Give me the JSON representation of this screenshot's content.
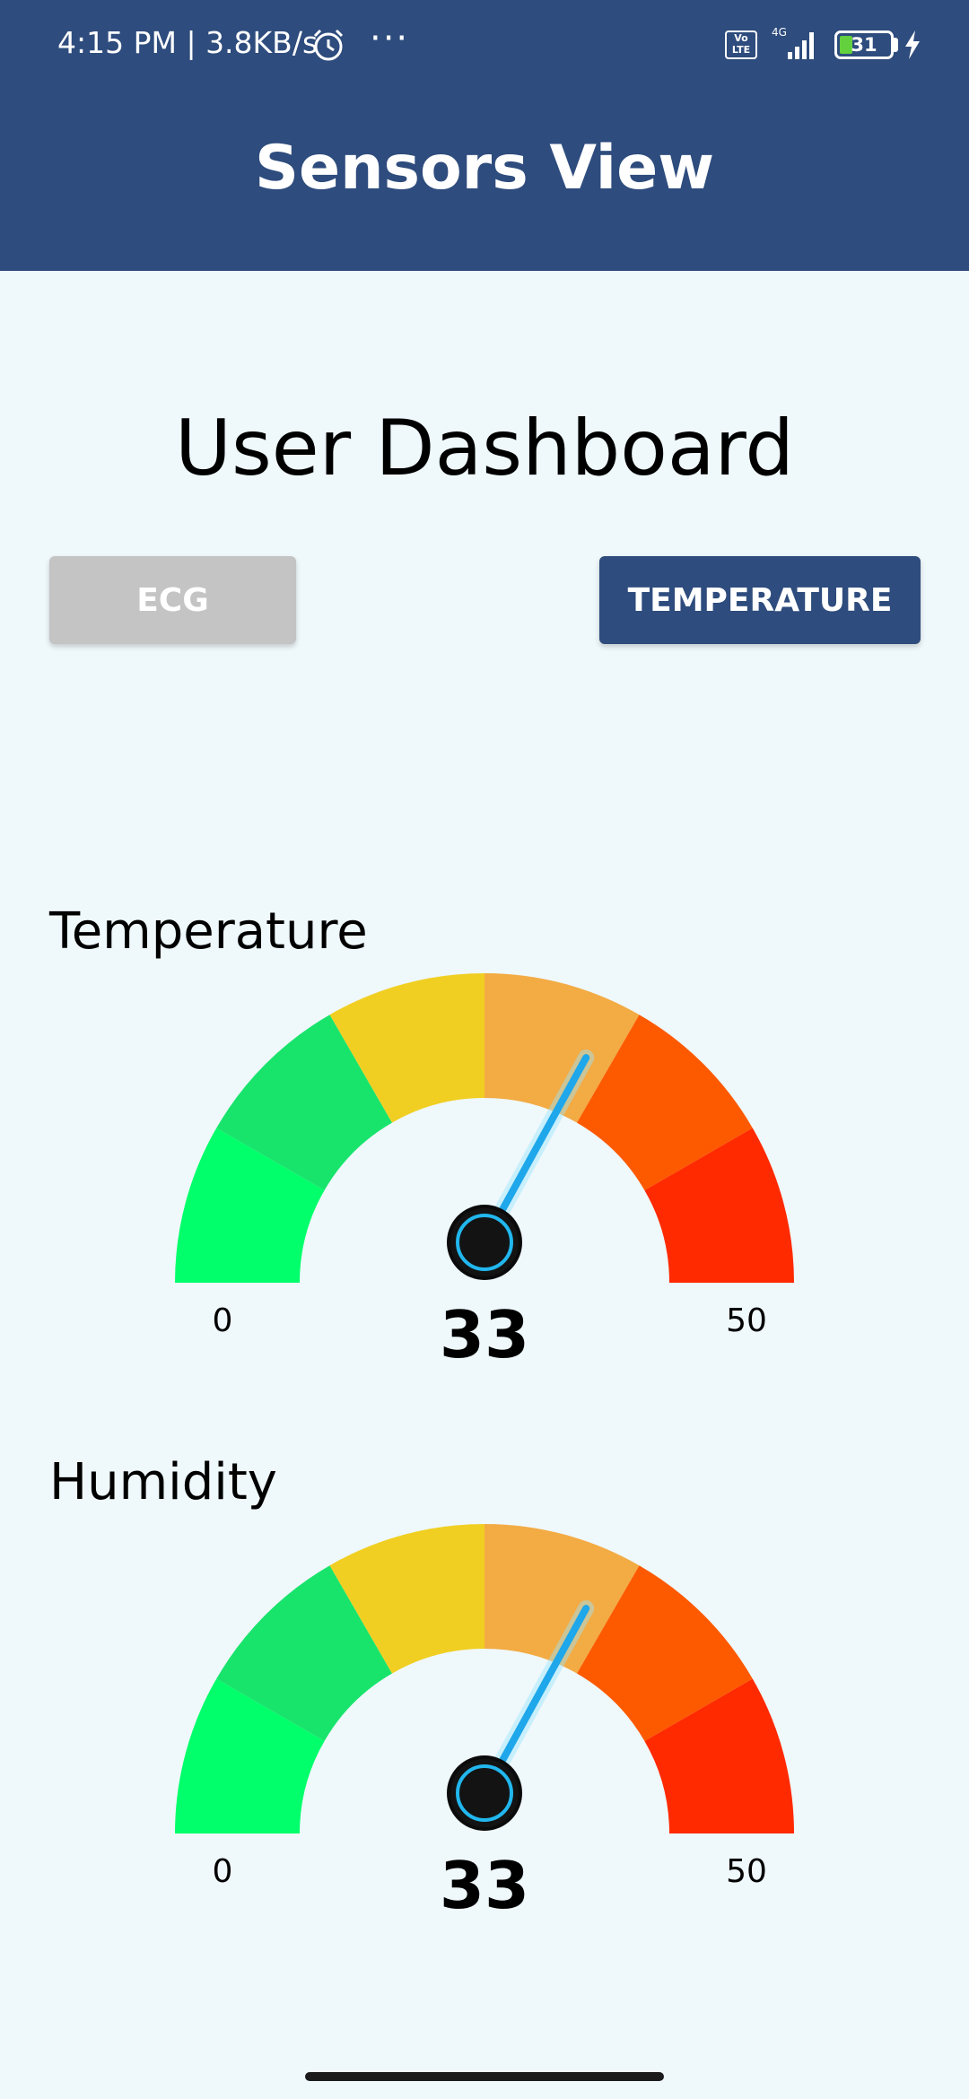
{
  "status_bar": {
    "time": "4:15 PM | 3.8KB/s",
    "dots": "···",
    "volte": "Vo LTE",
    "network": "4G",
    "battery": "31"
  },
  "header": {
    "title": "Sensors View"
  },
  "main": {
    "title": "User Dashboard",
    "buttons": {
      "ecg": "ECG",
      "temperature": "TEMPERATURE"
    }
  },
  "gauges": [
    {
      "label": "Temperature",
      "min_label": "0",
      "max_label": "50",
      "value_label": "33",
      "min": 0,
      "max": 50,
      "value": 33
    },
    {
      "label": "Humidity",
      "min_label": "0",
      "max_label": "50",
      "value_label": "33",
      "min": 0,
      "max": 50,
      "value": 33
    }
  ],
  "colors": {
    "header": "#2e4c7d",
    "background": "#eff8fb",
    "button_inactive": "#c4c4c4",
    "button_active": "#2e4c7d",
    "needle": "#1ea7ea",
    "segments": [
      "#00ff6a",
      "#18e46c",
      "#f0cf22",
      "#f3ab44",
      "#fd5a00",
      "#ff2a00"
    ]
  },
  "icons": {
    "alarm": "alarm-clock-icon",
    "signal": "cellular-signal-icon",
    "battery": "battery-icon",
    "charging": "charging-bolt-icon"
  }
}
